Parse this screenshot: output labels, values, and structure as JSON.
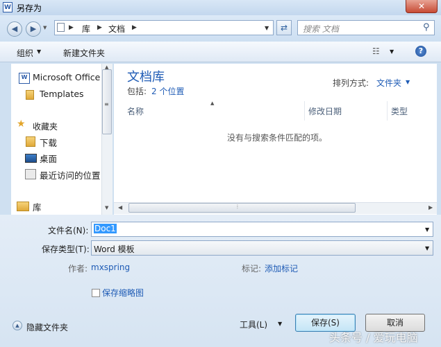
{
  "window": {
    "title": "另存为",
    "close_glyph": "✕",
    "app_icon_letter": "W"
  },
  "address": {
    "crumbs": [
      "库",
      "文档"
    ],
    "search_placeholder": "搜索 文档"
  },
  "toolbar": {
    "organize": "组织",
    "new_folder": "新建文件夹"
  },
  "nav": {
    "items": [
      {
        "label": "Microsoft Office",
        "icon": "word-icon"
      },
      {
        "label": "Templates",
        "icon": "folder-icon"
      },
      {
        "label": "收藏夹",
        "icon": "star-icon"
      },
      {
        "label": "下载",
        "icon": "download-folder-icon"
      },
      {
        "label": "桌面",
        "icon": "desktop-icon"
      },
      {
        "label": "最近访问的位置",
        "icon": "recent-places-icon"
      },
      {
        "label": "库",
        "icon": "library-icon"
      }
    ]
  },
  "content": {
    "library_title": "文档库",
    "includes_label": "包括:",
    "includes_link": "2 个位置",
    "sort_label": "排列方式:",
    "sort_value": "文件夹",
    "columns": [
      "名称",
      "修改日期",
      "类型"
    ],
    "empty_message": "没有与搜索条件匹配的项。"
  },
  "form": {
    "filename_label": "文件名(N):",
    "filename_value": "Doc1",
    "filetype_label": "保存类型(T):",
    "filetype_value": "Word 模板",
    "author_label": "作者:",
    "author_value": "mxspring",
    "tags_label": "标记:",
    "tags_value": "添加标记",
    "thumbnail_label": "保存缩略图",
    "thumbnail_checked": false
  },
  "footer": {
    "hide_folders": "隐藏文件夹",
    "tools": "工具(L)",
    "save": "保存(S)",
    "cancel": "取消"
  },
  "watermark": "头条号 / 爱玩电脑",
  "colors": {
    "link": "#1e5bb5",
    "title_bar": "#c3d7ee",
    "close": "#c74b35"
  }
}
